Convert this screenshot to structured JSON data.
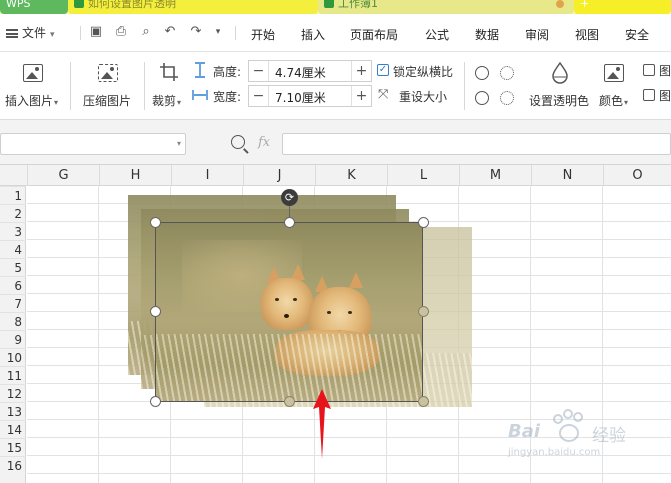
{
  "tabs": [
    {
      "label": "WPS"
    },
    {
      "label": "如何设置图片透明"
    },
    {
      "label": "工作簿1"
    },
    {
      "label": "+"
    }
  ],
  "menubar": {
    "file_label": "文件",
    "items": [
      "开始",
      "插入",
      "页面布局",
      "公式",
      "数据",
      "审阅",
      "视图",
      "安全"
    ]
  },
  "ribbon": {
    "insert_picture": "插入图片",
    "compress_picture": "压缩图片",
    "crop": "裁剪",
    "height_label": "高度:",
    "height_value": "4.74厘米",
    "width_label": "宽度:",
    "width_value": "7.10厘米",
    "lock_ratio": "锁定纵横比",
    "reset_size": "重设大小",
    "set_transparent": "设置透明色",
    "color": "颜色",
    "more_1": "图",
    "more_2": "图",
    "lock_ratio_checked": true
  },
  "formula": {
    "fx": "fx"
  },
  "columns": [
    "G",
    "H",
    "I",
    "J",
    "K",
    "L",
    "M",
    "N",
    "O"
  ],
  "rows": [
    "1",
    "2",
    "3",
    "4",
    "5",
    "6",
    "7",
    "8",
    "9",
    "10",
    "11",
    "12",
    "13",
    "14",
    "15",
    "16"
  ],
  "watermark": {
    "text": "Bai",
    "text2": "经验",
    "sub": "jingyan.baidu.com"
  },
  "colors": {
    "arrow": "#e8141b",
    "accent": "#2f7fce"
  }
}
